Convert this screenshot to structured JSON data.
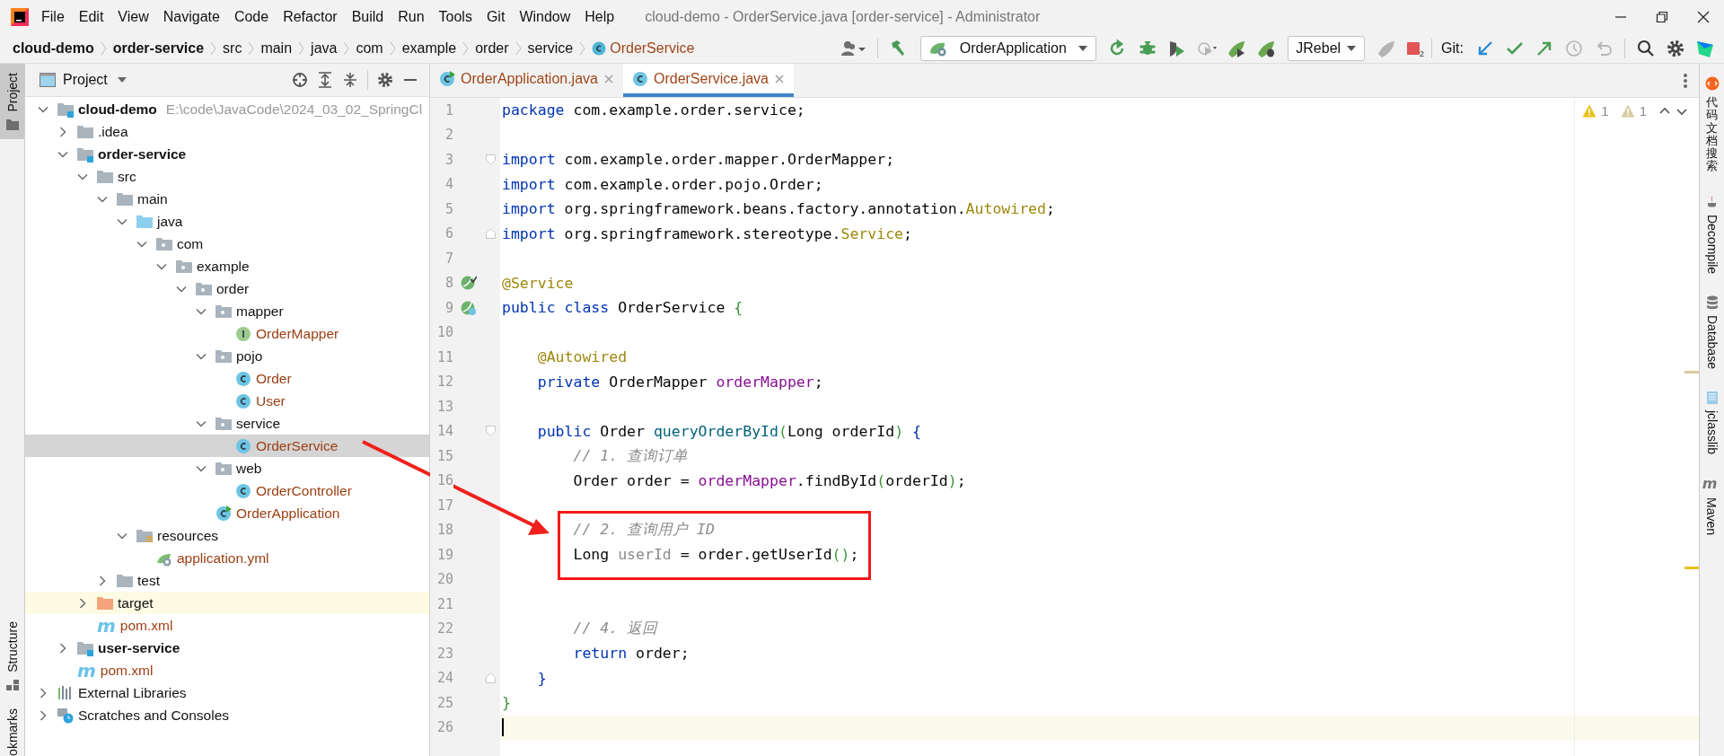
{
  "menu": [
    {
      "label": "File"
    },
    {
      "label": "Edit"
    },
    {
      "label": "View"
    },
    {
      "label": "Navigate"
    },
    {
      "label": "Code"
    },
    {
      "label": "Refactor"
    },
    {
      "label": "Build"
    },
    {
      "label": "Run"
    },
    {
      "label": "Tools"
    },
    {
      "label": "Git"
    },
    {
      "label": "Window"
    },
    {
      "label": "Help"
    }
  ],
  "window": {
    "title": "cloud-demo - OrderService.java [order-service] - Administrator"
  },
  "breadcrumbs": [
    {
      "label": "cloud-demo",
      "kind": "module"
    },
    {
      "label": "order-service",
      "kind": "module"
    },
    {
      "label": "src",
      "kind": "folder"
    },
    {
      "label": "main",
      "kind": "folder"
    },
    {
      "label": "java",
      "kind": "folder"
    },
    {
      "label": "com",
      "kind": "folder"
    },
    {
      "label": "example",
      "kind": "folder"
    },
    {
      "label": "order",
      "kind": "folder"
    },
    {
      "label": "service",
      "kind": "folder"
    },
    {
      "label": "OrderService",
      "kind": "class"
    }
  ],
  "toolbar": [
    {
      "kind": "user",
      "disabled": false
    },
    {
      "kind": "sep"
    },
    {
      "kind": "build",
      "disabled": false
    },
    {
      "kind": "run-config",
      "label": "OrderApplication",
      "disabled": false
    },
    {
      "kind": "rerun",
      "disabled": false
    },
    {
      "kind": "debug",
      "disabled": false
    },
    {
      "kind": "coverage",
      "disabled": false
    },
    {
      "kind": "profile",
      "disabled": true
    },
    {
      "kind": "jrebel-run",
      "disabled": false
    },
    {
      "kind": "jrebel-debug",
      "disabled": false
    },
    {
      "kind": "dropdown",
      "label": "JRebel",
      "disabled": false
    },
    {
      "kind": "rocket",
      "disabled": true
    },
    {
      "kind": "stop",
      "badge": "2",
      "disabled": false
    },
    {
      "kind": "sep"
    },
    {
      "kind": "label",
      "label": "Git:"
    },
    {
      "kind": "git-update",
      "disabled": false
    },
    {
      "kind": "git-commit",
      "disabled": false
    },
    {
      "kind": "git-push",
      "disabled": false
    },
    {
      "kind": "history",
      "disabled": true
    },
    {
      "kind": "rollback",
      "disabled": true
    },
    {
      "kind": "sep"
    },
    {
      "kind": "search",
      "disabled": false
    },
    {
      "kind": "settings",
      "disabled": false
    },
    {
      "kind": "toolbox"
    }
  ],
  "left_stripe": [
    {
      "label": "Project",
      "selected": true
    },
    {
      "label": "Structure",
      "selected": false
    },
    {
      "label": "okmarks",
      "selected": false
    }
  ],
  "project_panel": {
    "title": "Project"
  },
  "tree": [
    {
      "label": "cloud-demo",
      "kind": "module",
      "hint": "E:\\code\\JavaCode\\2024_03_02_SpringCl",
      "expanded": true,
      "selected": false,
      "children": [
        {
          "label": ".idea",
          "kind": "folder",
          "expanded": false,
          "selected": false
        },
        {
          "label": "order-service",
          "kind": "module",
          "expanded": true,
          "selected": false,
          "children": [
            {
              "label": "src",
              "kind": "folder",
              "expanded": true,
              "selected": false,
              "children": [
                {
                  "label": "main",
                  "kind": "folder",
                  "expanded": true,
                  "selected": false,
                  "children": [
                    {
                      "label": "java",
                      "kind": "source-root",
                      "expanded": true,
                      "selected": false,
                      "children": [
                        {
                          "label": "com",
                          "kind": "package",
                          "expanded": true,
                          "selected": false,
                          "children": [
                            {
                              "label": "example",
                              "kind": "package",
                              "expanded": true,
                              "selected": false,
                              "children": [
                                {
                                  "label": "order",
                                  "kind": "package",
                                  "expanded": true,
                                  "selected": false,
                                  "children": [
                                    {
                                      "label": "mapper",
                                      "kind": "package",
                                      "expanded": true,
                                      "selected": false,
                                      "children": [
                                        {
                                          "label": "OrderMapper",
                                          "kind": "interface",
                                          "selected": false
                                        }
                                      ]
                                    },
                                    {
                                      "label": "pojo",
                                      "kind": "package",
                                      "expanded": true,
                                      "selected": false,
                                      "children": [
                                        {
                                          "label": "Order",
                                          "kind": "class",
                                          "selected": false
                                        },
                                        {
                                          "label": "User",
                                          "kind": "class",
                                          "selected": false
                                        }
                                      ]
                                    },
                                    {
                                      "label": "service",
                                      "kind": "package",
                                      "expanded": true,
                                      "selected": false,
                                      "children": [
                                        {
                                          "label": "OrderService",
                                          "kind": "class",
                                          "selected": true
                                        }
                                      ]
                                    },
                                    {
                                      "label": "web",
                                      "kind": "package",
                                      "expanded": true,
                                      "selected": false,
                                      "children": [
                                        {
                                          "label": "OrderController",
                                          "kind": "class",
                                          "selected": false
                                        }
                                      ]
                                    },
                                    {
                                      "label": "OrderApplication",
                                      "kind": "app-class",
                                      "selected": false
                                    }
                                  ]
                                }
                              ]
                            }
                          ]
                        }
                      ]
                    },
                    {
                      "label": "resources",
                      "kind": "resource-root",
                      "expanded": true,
                      "selected": false,
                      "children": [
                        {
                          "label": "application.yml",
                          "kind": "yml",
                          "selected": false
                        }
                      ]
                    }
                  ]
                },
                {
                  "label": "test",
                  "kind": "folder",
                  "expanded": false,
                  "selected": false
                }
              ]
            },
            {
              "label": "target",
              "kind": "excluded",
              "expanded": false,
              "selected": false
            },
            {
              "label": "pom.xml",
              "kind": "maven",
              "glyph": "m",
              "selected": false
            }
          ]
        },
        {
          "label": "user-service",
          "kind": "module",
          "expanded": false,
          "selected": false
        },
        {
          "label": "pom.xml",
          "kind": "maven",
          "glyph": "m",
          "selected": false
        }
      ]
    },
    {
      "label": "External Libraries",
      "kind": "libraries",
      "expanded": false,
      "selected": false
    },
    {
      "label": "Scratches and Consoles",
      "kind": "scratches",
      "expanded": false,
      "selected": false
    }
  ],
  "tabs": [
    {
      "label": "OrderApplication.java",
      "kind": "app-class",
      "selected": false
    },
    {
      "label": "OrderService.java",
      "kind": "class",
      "selected": true
    }
  ],
  "inspections": [
    {
      "kind": "warning",
      "count": "1"
    },
    {
      "kind": "weak-warning",
      "count": "1"
    }
  ],
  "code": [
    {
      "n": "1",
      "tokens": [
        {
          "kind": "kw",
          "text": "package"
        },
        {
          "kind": "p",
          "text": " com.example.order.service;"
        }
      ]
    },
    {
      "n": "2"
    },
    {
      "n": "3",
      "fold": {
        "kind": "start"
      },
      "tokens": [
        {
          "kind": "kw",
          "text": "import"
        },
        {
          "kind": "p",
          "text": " com.example.order.mapper.OrderMapper;"
        }
      ]
    },
    {
      "n": "4",
      "tokens": [
        {
          "kind": "kw",
          "text": "import"
        },
        {
          "kind": "p",
          "text": " com.example.order.pojo.Order;"
        }
      ]
    },
    {
      "n": "5",
      "tokens": [
        {
          "kind": "kw",
          "text": "import"
        },
        {
          "kind": "p",
          "text": " org.springframework.beans.factory.annotation."
        },
        {
          "kind": "ann",
          "text": "Autowired"
        },
        {
          "kind": "p",
          "text": ";"
        }
      ]
    },
    {
      "n": "6",
      "fold": {
        "kind": "end"
      },
      "tokens": [
        {
          "kind": "kw",
          "text": "import"
        },
        {
          "kind": "p",
          "text": " org.springframework.stereotype."
        },
        {
          "kind": "ann",
          "text": "Service"
        },
        {
          "kind": "p",
          "text": ";"
        }
      ]
    },
    {
      "n": "7"
    },
    {
      "n": "8",
      "gutter": {
        "kind": "bean"
      },
      "tokens": [
        {
          "kind": "ann",
          "text": "@Service"
        }
      ]
    },
    {
      "n": "9",
      "gutter": {
        "kind": "bean-class"
      },
      "tokens": [
        {
          "kind": "kw",
          "text": "public class"
        },
        {
          "kind": "p",
          "text": " OrderService "
        },
        {
          "kind": "br",
          "text": "{"
        }
      ]
    },
    {
      "n": "10"
    },
    {
      "n": "11",
      "tokens": [
        {
          "kind": "ann",
          "text": "    @Autowired"
        }
      ]
    },
    {
      "n": "12",
      "tokens": [
        {
          "kind": "kw",
          "text": "    private"
        },
        {
          "kind": "p",
          "text": " OrderMapper "
        },
        {
          "kind": "fld",
          "text": "orderMapper"
        },
        {
          "kind": "p",
          "text": ";"
        }
      ]
    },
    {
      "n": "13"
    },
    {
      "n": "14",
      "fold": {
        "kind": "start"
      },
      "tokens": [
        {
          "kind": "kw",
          "text": "    public"
        },
        {
          "kind": "p",
          "text": " Order "
        },
        {
          "kind": "mth",
          "text": "queryOrderById"
        },
        {
          "kind": "br",
          "text": "("
        },
        {
          "kind": "p",
          "text": "Long orderId"
        },
        {
          "kind": "br",
          "text": ")"
        },
        {
          "kind": "br2",
          "text": " {"
        }
      ]
    },
    {
      "n": "15",
      "tokens": [
        {
          "kind": "cmt",
          "text": "        // 1. 查询订单"
        }
      ]
    },
    {
      "n": "16",
      "tokens": [
        {
          "kind": "p",
          "text": "        Order order = "
        },
        {
          "kind": "fld",
          "text": "orderMapper"
        },
        {
          "kind": "p",
          "text": ".findById"
        },
        {
          "kind": "br",
          "text": "("
        },
        {
          "kind": "p",
          "text": "orderId"
        },
        {
          "kind": "br",
          "text": ")"
        },
        {
          "kind": "p",
          "text": ";"
        }
      ]
    },
    {
      "n": "17"
    },
    {
      "n": "18",
      "boxed": true,
      "tokens": [
        {
          "kind": "cmt",
          "text": "        // 2. 查询用户 ID"
        }
      ]
    },
    {
      "n": "19",
      "boxed": true,
      "tokens": [
        {
          "kind": "p",
          "text": "        Long "
        },
        {
          "kind": "unused",
          "text": "userId"
        },
        {
          "kind": "p",
          "text": " = order.getUserId"
        },
        {
          "kind": "br",
          "text": "()"
        },
        {
          "kind": "p",
          "text": ";"
        }
      ]
    },
    {
      "n": "20"
    },
    {
      "n": "21"
    },
    {
      "n": "22",
      "tokens": [
        {
          "kind": "cmt",
          "text": "        // 4. 返回"
        }
      ]
    },
    {
      "n": "23",
      "tokens": [
        {
          "kind": "kw",
          "text": "        return"
        },
        {
          "kind": "p",
          "text": " order;"
        }
      ]
    },
    {
      "n": "24",
      "fold": {
        "kind": "end"
      },
      "tokens": [
        {
          "kind": "br2",
          "text": "    }"
        }
      ]
    },
    {
      "n": "25",
      "tokens": [
        {
          "kind": "br",
          "text": "}"
        }
      ]
    },
    {
      "n": "26",
      "current": true
    }
  ],
  "right_stripe": [
    {
      "label": "代码文档搜索",
      "kind": "docsearch"
    },
    {
      "label": "Decompile",
      "kind": "decompile"
    },
    {
      "label": "Database",
      "kind": "database"
    },
    {
      "label": "jclasslib",
      "kind": "jclasslib"
    },
    {
      "label": "Maven",
      "kind": "maven",
      "glyph": "m"
    }
  ]
}
